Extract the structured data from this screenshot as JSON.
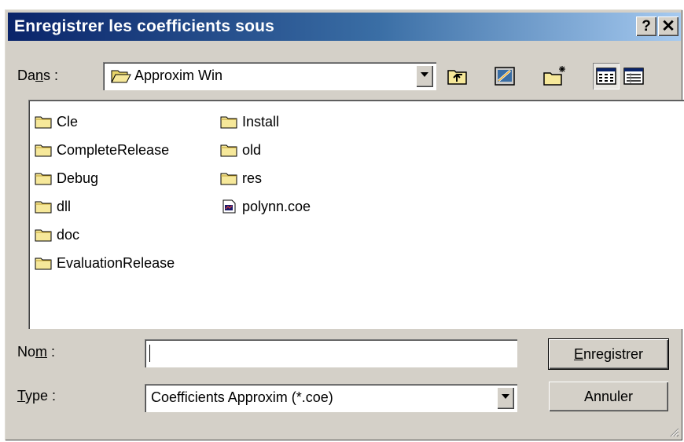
{
  "dialog": {
    "title": "Enregistrer les coefficients sous",
    "help_button": "?",
    "close_button": "✕"
  },
  "location": {
    "label_pre": "Da",
    "label_mnemonic": "n",
    "label_post": "s :",
    "current_folder": "Approxim Win"
  },
  "toolbar": {
    "up_folder_icon": "up-one-level-icon",
    "desktop_icon": "desktop-icon",
    "new_folder_icon": "new-folder-icon",
    "list_view_icon": "list-view-icon",
    "details_view_icon": "details-view-icon"
  },
  "files": {
    "col1": [
      {
        "name": "Cle",
        "kind": "folder"
      },
      {
        "name": "CompleteRelease",
        "kind": "folder"
      },
      {
        "name": "Debug",
        "kind": "folder"
      },
      {
        "name": "dll",
        "kind": "folder"
      },
      {
        "name": "doc",
        "kind": "folder"
      },
      {
        "name": "EvaluationRelease",
        "kind": "folder"
      }
    ],
    "col2": [
      {
        "name": "Install",
        "kind": "folder"
      },
      {
        "name": "old",
        "kind": "folder"
      },
      {
        "name": "res",
        "kind": "folder"
      },
      {
        "name": "polynn.coe",
        "kind": "file"
      }
    ]
  },
  "name_field": {
    "label_pre": "No",
    "label_mnemonic": "m",
    "label_post": " :",
    "value": ""
  },
  "type_field": {
    "label_mnemonic": "T",
    "label_post": "ype :",
    "value": "Coefficients Approxim (*.coe)"
  },
  "buttons": {
    "save_mnemonic": "E",
    "save_rest": "nregistrer",
    "cancel": "Annuler"
  },
  "colors": {
    "title_start": "#0a246a",
    "title_end": "#a6caf0",
    "face": "#d4d0c8",
    "folder_yellow": "#f6e89a"
  }
}
